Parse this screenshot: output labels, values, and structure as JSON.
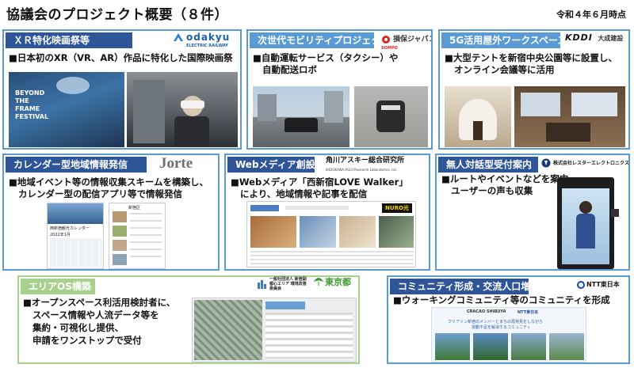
{
  "page": {
    "title": "協議会のプロジェクト概要（８件）",
    "date": "令和４年６月時点"
  },
  "cards": {
    "xr": {
      "header": "ＸＲ特化映画祭等",
      "logo": {
        "main": "odakyu",
        "sub": "ELECTRIC RAILWAY"
      },
      "desc": [
        "■日本初のXR（VR、AR）作品に特化した国際映画祭"
      ],
      "photo_text": [
        "BEYOND",
        "THE",
        "FRAME",
        "FESTIVAL"
      ]
    },
    "mobility": {
      "header": "次世代モビリティプロジェクト",
      "logo": {
        "main": "損保ジャパン",
        "sub": "SOMPO"
      },
      "desc": [
        "■自動運転サービス（タクシー）や",
        "自動配送ロボ"
      ]
    },
    "fiveg": {
      "header": "5G活用屋外ワークスペース",
      "logo": {
        "main": "KDDI",
        "sub": "大成建設"
      },
      "desc": [
        "■大型テントを新宿中央公園等に設置し、",
        "オンライン会議等に活用"
      ]
    },
    "calendar": {
      "header": "カレンダー型地域情報発信",
      "logo": {
        "main": "Jorte"
      },
      "desc": [
        "■地域イベント等の情報収集スキームを構築し、",
        "カレンダー型の配信アプリ等で情報発信"
      ],
      "screen_text": [
        "西新宿観光カレンダー",
        "2022年1月",
        "新宿区"
      ]
    },
    "webmedia": {
      "header": "Webメディア創設",
      "logo": {
        "main": "角川アスキー総合研究所",
        "sub": "KADOKAWA ASCII Research Laboratories, Inc."
      },
      "desc": [
        "■Webメディア「西新宿LOVE Walker」",
        "により、地域情報や記事を配信"
      ],
      "screen_text": [
        "NURO光"
      ]
    },
    "guide": {
      "header": "無人対話型受付案内",
      "logo": {
        "main": "株式会社レスターエレクトロニクス"
      },
      "desc": [
        "■ルートやイベントなどを案内、",
        "ユーザーの声も収集"
      ]
    },
    "area": {
      "header": "エリアOS構築",
      "logo": {
        "main": "一般社団法人 新宿副都心エリア 環境改善委員会",
        "sub": "東京都"
      },
      "desc": [
        "■オープンスペース利活用検討者に、",
        "スペース情報や人流データ等を",
        "集約・可視化し提供、",
        "申請をワンストップで受付"
      ]
    },
    "community": {
      "header": "コミュニティ形成・交流人口増加",
      "logo": {
        "main": "NTT東日本"
      },
      "desc": [
        "■ウォーキングコミュニティ等のコミュニティを形成"
      ],
      "screen_text": [
        "CRACAO SHIBUYA",
        "NTT東日本",
        "クリアソン新宿のメンバーとまちの再発見をしながら",
        "運動不足を解消するコミュニティ"
      ]
    }
  }
}
